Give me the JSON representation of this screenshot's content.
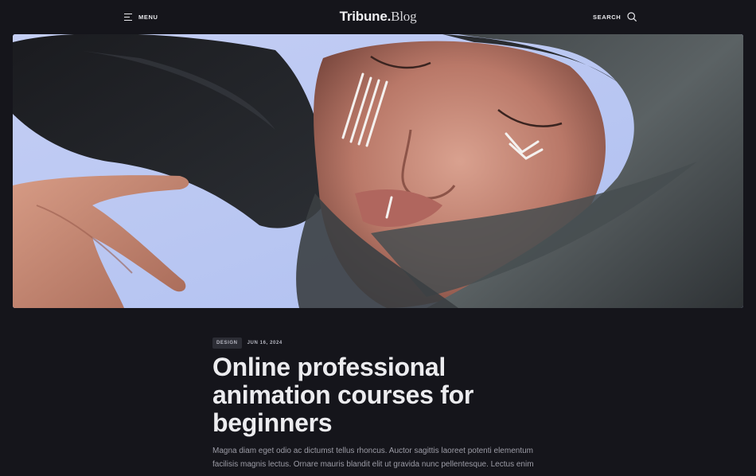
{
  "header": {
    "menu_label": "MENU",
    "logo_strong": "Tribune.",
    "logo_light": "Blog",
    "search_label": "SEARCH",
    "icons": {
      "menu": "hamburger-icon",
      "search": "search-icon"
    }
  },
  "hero": {
    "background_color": "#b9c7f2"
  },
  "article": {
    "category": "DESIGN",
    "date": "JUN 16, 2024",
    "title": "Online professional animation courses for beginners",
    "excerpt": "Magna diam eget odio ac dictumst tellus rhoncus. Auctor sagittis laoreet potenti elementum facilisis magnis lectus. Ornare mauris blandit elit ut gravida nunc pellentesque. Lectus enim"
  },
  "colors": {
    "background": "#15151b",
    "text": "#ececef",
    "muted": "#9c9ca6",
    "badge_bg": "#2c2d35"
  }
}
